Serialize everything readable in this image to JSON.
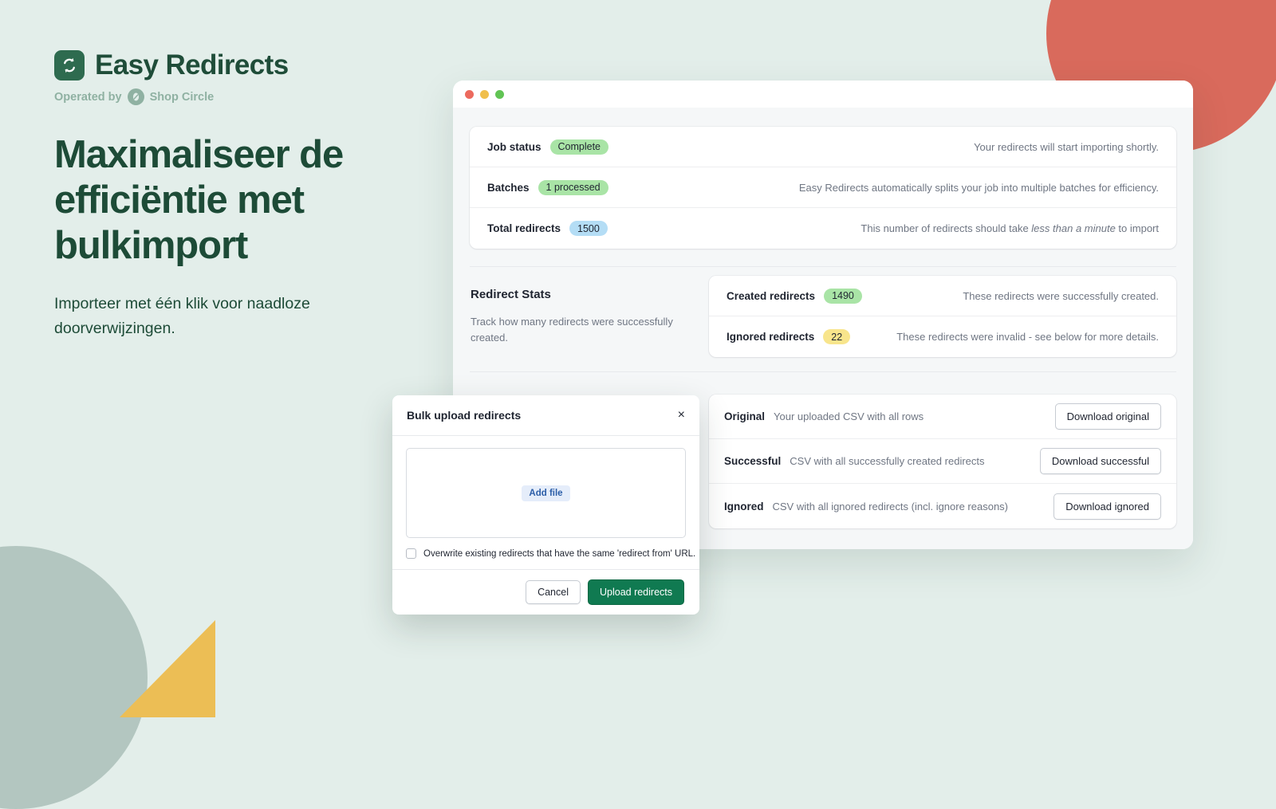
{
  "brand": {
    "logo_icon": "refresh-arrows-icon",
    "name": "Easy Redirects",
    "operated_by": "Operated by",
    "partner_icon": "shop-circle-icon",
    "partner_name": "Shop Circle"
  },
  "hero": {
    "headline": "Maximaliseer de efficiëntie met bulkimport",
    "subheadline": "Importeer met één klik voor naadloze doorverwijzingen."
  },
  "colors": {
    "page_background": "#e3eeea",
    "brand_green": "#1d4b37",
    "logo_green": "#2e6b4f",
    "partner_gray_green": "#8fb1a2",
    "primary_button": "#107a51",
    "deco_red": "#d96a5c",
    "deco_yellow": "#ecbe55",
    "deco_gray": "#b3c6c0",
    "badge_green": "#a9e4a6",
    "badge_blue": "#b4ddf5",
    "badge_yellow": "#f8e58c",
    "add_file_blue": "#2c5ea8"
  },
  "window": {
    "dots": [
      "close-dot-red",
      "minimize-dot-yellow",
      "maximize-dot-green"
    ]
  },
  "job_rows": [
    {
      "label": "Job status",
      "badge": "Complete",
      "badge_color": "green",
      "description": "Your redirects will start importing shortly."
    },
    {
      "label": "Batches",
      "badge": "1 processed",
      "badge_color": "green",
      "description": "Easy Redirects automatically splits your job into multiple batches for efficiency."
    },
    {
      "label": "Total redirects",
      "badge": "1500",
      "badge_color": "blue",
      "description_prefix": "This number of redirects should take ",
      "description_italic": "less than a minute",
      "description_suffix": " to import"
    }
  ],
  "stats_section": {
    "title": "Redirect Stats",
    "description": "Track how many redirects were successfully created.",
    "rows": [
      {
        "label": "Created redirects",
        "badge": "1490",
        "badge_color": "green",
        "description": "These redirects were successfully created."
      },
      {
        "label": "Ignored redirects",
        "badge": "22",
        "badge_color": "yellow",
        "description": "These redirects were invalid - see below for more details."
      }
    ]
  },
  "downloads": [
    {
      "label": "Original",
      "description": "Your uploaded CSV with all rows",
      "button": "Download original"
    },
    {
      "label": "Successful",
      "description": "CSV with all successfully created redirects",
      "button": "Download successful"
    },
    {
      "label": "Ignored",
      "description": "CSV with all ignored redirects (incl. ignore reasons)",
      "button": "Download ignored"
    }
  ],
  "modal": {
    "title": "Bulk upload redirects",
    "close_icon": "×",
    "add_file_label": "Add file",
    "overwrite_label": "Overwrite existing redirects that have the same 'redirect from' URL.",
    "overwrite_checked": false,
    "cancel_label": "Cancel",
    "submit_label": "Upload redirects"
  }
}
